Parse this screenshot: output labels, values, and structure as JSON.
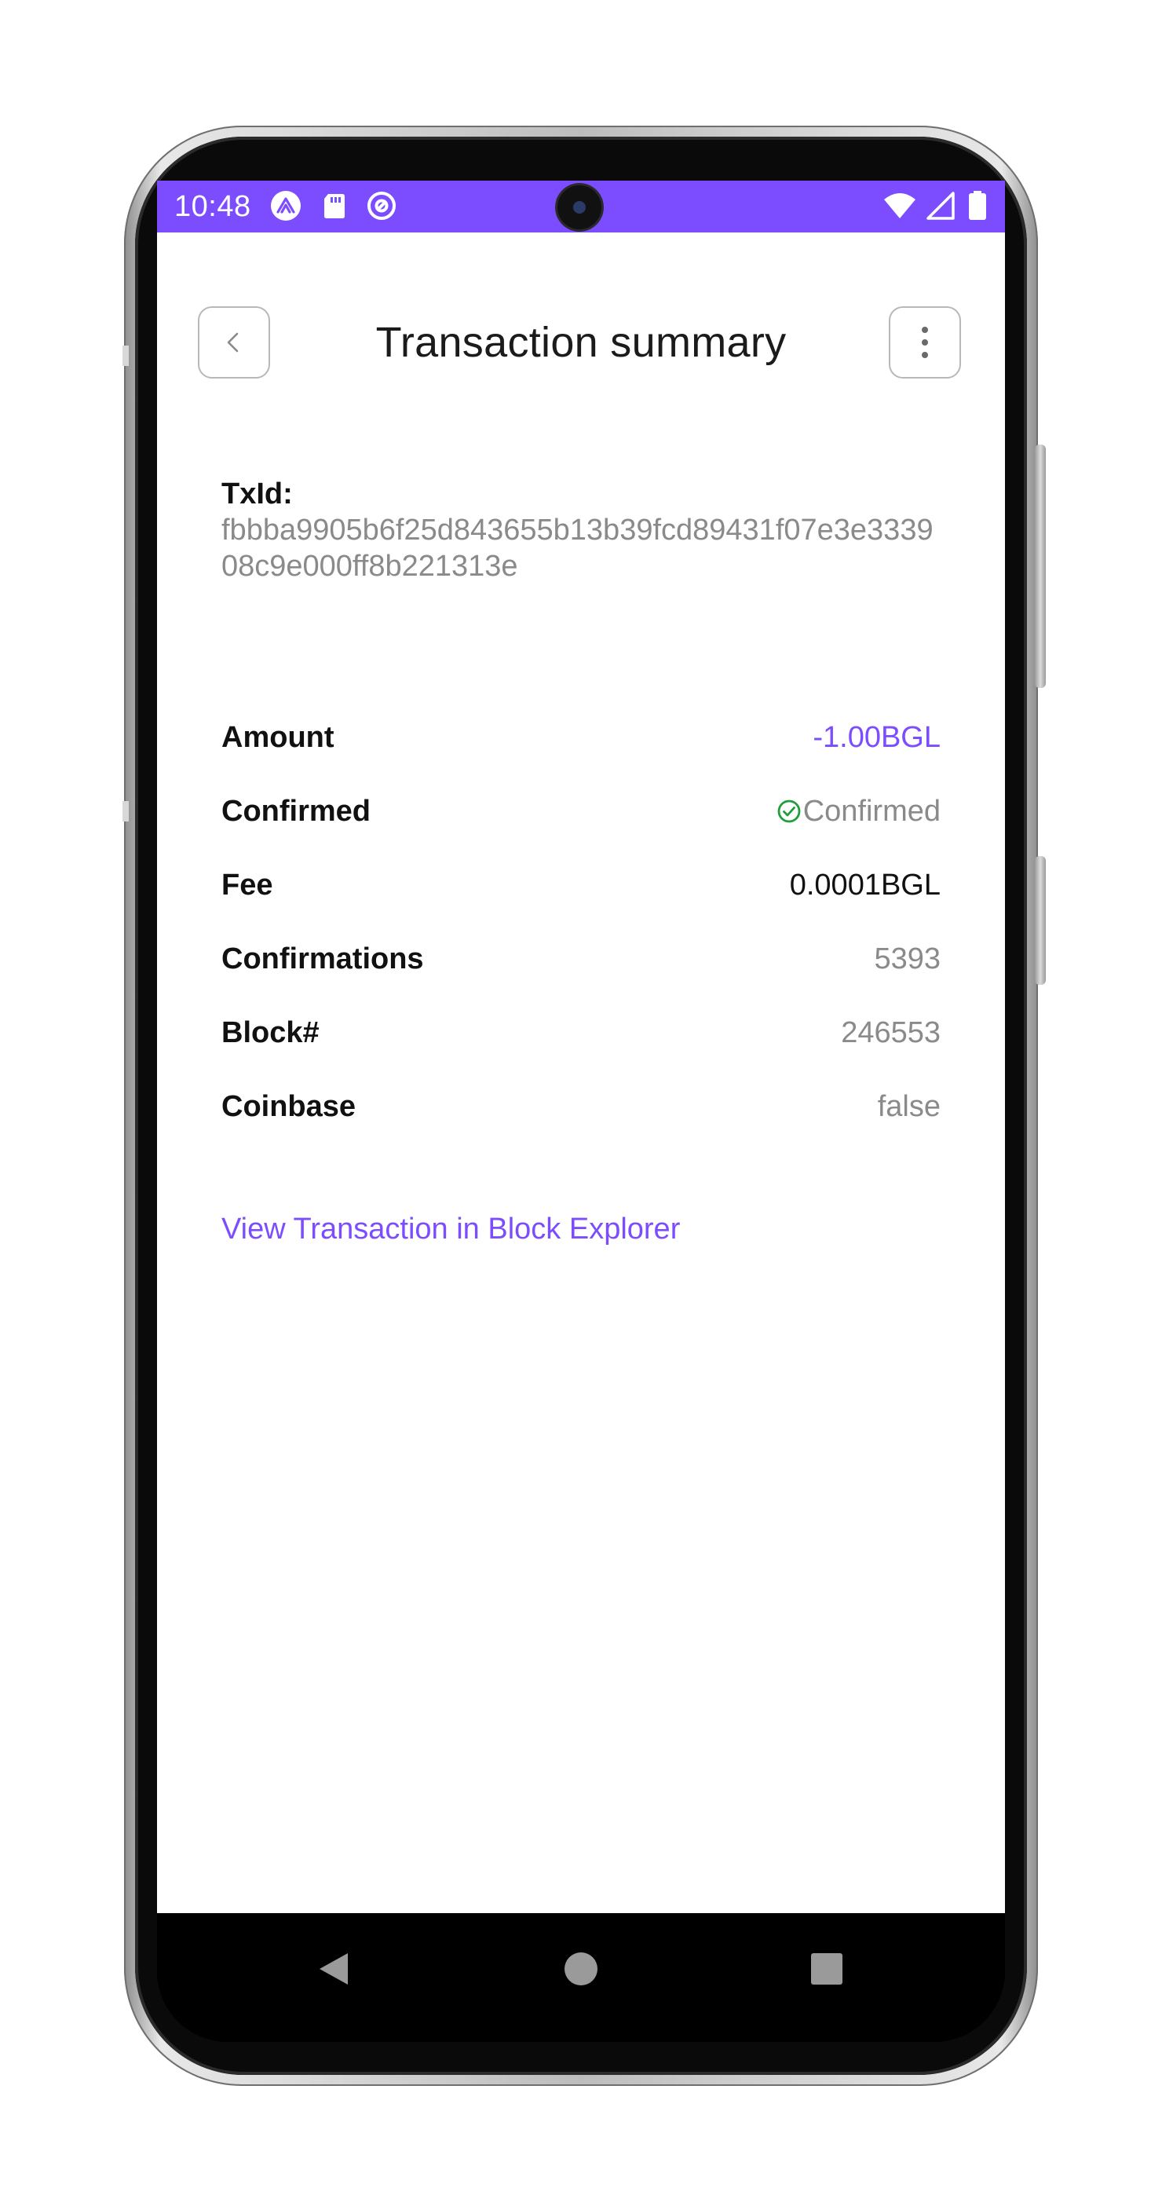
{
  "status_bar": {
    "time": "10:48",
    "left_icons": [
      "expo-icon",
      "sd-card-icon",
      "at-sign-icon"
    ],
    "right_icons": [
      "wifi-icon",
      "cellular-signal-icon",
      "battery-icon"
    ],
    "background": "#7c4dff"
  },
  "header": {
    "title": "Transaction summary",
    "back_icon": "chevron-left-icon",
    "menu_icon": "more-vertical-icon"
  },
  "transaction": {
    "txid_label": "TxId:",
    "txid_value": "fbbba9905b6f25d843655b13b39fcd89431f07e3e333908c9e000ff8b221313e"
  },
  "details": {
    "rows": [
      {
        "label": "Amount",
        "value": "-1.00BGL"
      },
      {
        "label": "Confirmed",
        "value": "Confirmed",
        "icon": "check-circle-icon"
      },
      {
        "label": "Fee",
        "value": "0.0001BGL"
      },
      {
        "label": "Confirmations",
        "value": "5393"
      },
      {
        "label": "Block#",
        "value": "246553"
      },
      {
        "label": "Coinbase",
        "value": "false"
      }
    ]
  },
  "links": {
    "block_explorer": "View Transaction in Block Explorer"
  },
  "navigation": {
    "buttons": [
      "nav-back-icon",
      "nav-home-icon",
      "nav-recents-icon"
    ]
  },
  "colors": {
    "accent": "#7c4dff",
    "muted_text": "#8a8a8a",
    "success": "#1f9e3a"
  }
}
